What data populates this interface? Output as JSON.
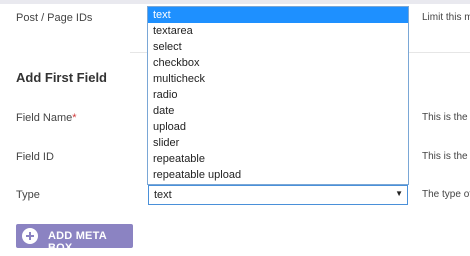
{
  "post_ids": {
    "label": "Post / Page IDs",
    "help": "Limit this m"
  },
  "section": {
    "title": "Add First Field"
  },
  "fields": {
    "name": {
      "label": "Field Name",
      "required_mark": "*",
      "help": "This is the n"
    },
    "id": {
      "label": "Field ID",
      "help": "This is the u"
    },
    "type": {
      "label": "Type",
      "help": "The type of",
      "value": "text"
    }
  },
  "dropdown": {
    "options": [
      "text",
      "textarea",
      "select",
      "checkbox",
      "multicheck",
      "radio",
      "date",
      "upload",
      "slider",
      "repeatable",
      "repeatable upload"
    ],
    "highlighted": "text"
  },
  "button": {
    "label": "ADD META BOX"
  },
  "colors": {
    "button_bg": "#8b83c2",
    "highlight": "#1e90ff",
    "required": "#d23b3b"
  },
  "icons": {
    "button": "plus-circle-icon",
    "select_caret": "caret-down-icon"
  }
}
